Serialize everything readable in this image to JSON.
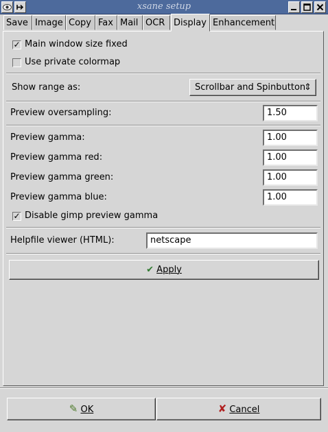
{
  "window": {
    "title": "xsane setup"
  },
  "tabs": [
    {
      "label": "Save"
    },
    {
      "label": "Image"
    },
    {
      "label": "Copy"
    },
    {
      "label": "Fax"
    },
    {
      "label": "Mail"
    },
    {
      "label": "OCR"
    },
    {
      "label": "Display",
      "active": true
    },
    {
      "label": "Enhancement"
    }
  ],
  "display": {
    "main_window_size_fixed": {
      "label": "Main window size fixed",
      "checked": true,
      "mark": "✓"
    },
    "use_private_colormap": {
      "label": "Use private colormap",
      "checked": false,
      "mark": ""
    },
    "show_range": {
      "label": "Show range as:",
      "value": "Scrollbar and Spinbutton",
      "arrows": "⇕"
    },
    "preview_oversampling": {
      "label": "Preview oversampling:",
      "value": "1.50"
    },
    "preview_gamma": {
      "label": "Preview gamma:",
      "value": "1.00"
    },
    "preview_gamma_red": {
      "label": "Preview gamma red:",
      "value": "1.00"
    },
    "preview_gamma_green": {
      "label": "Preview gamma green:",
      "value": "1.00"
    },
    "preview_gamma_blue": {
      "label": "Preview gamma blue:",
      "value": "1.00"
    },
    "disable_gimp_preview_gamma": {
      "label": "Disable gimp preview gamma",
      "checked": true,
      "mark": "✓"
    },
    "helpfile_viewer": {
      "label": "Helpfile viewer (HTML):",
      "value": "netscape"
    },
    "apply": {
      "label": "Apply",
      "icon": "✔"
    }
  },
  "buttons": {
    "ok": {
      "label": "OK",
      "icon": "✎"
    },
    "cancel": {
      "label": "Cancel",
      "icon": "✘"
    }
  },
  "colors": {
    "titlebar": "#4d6a9c",
    "background": "#d6d6d6",
    "apply_icon": "#2f7a2f",
    "cancel_icon": "#b02020"
  }
}
